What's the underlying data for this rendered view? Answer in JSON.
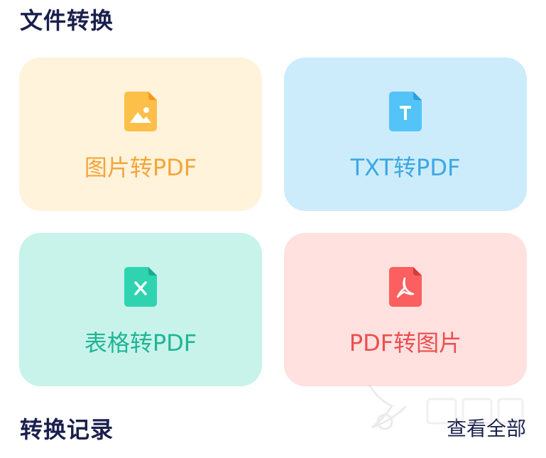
{
  "sections": {
    "file_convert_title": "文件转换",
    "history_title": "转换记录",
    "view_all": "查看全部"
  },
  "cards": [
    {
      "label": "图片转PDF",
      "icon": "image-file-icon",
      "bg": "#fff3dc",
      "color": "#f4a53a"
    },
    {
      "label": "TXT转PDF",
      "icon": "text-file-icon",
      "bg": "#ccecfc",
      "color": "#3ba7e3"
    },
    {
      "label": "表格转PDF",
      "icon": "spreadsheet-file-icon",
      "bg": "#c8f3eb",
      "color": "#21b594"
    },
    {
      "label": "PDF转图片",
      "icon": "pdf-file-icon",
      "bg": "#ffe1e0",
      "color": "#ea4f4f"
    }
  ]
}
